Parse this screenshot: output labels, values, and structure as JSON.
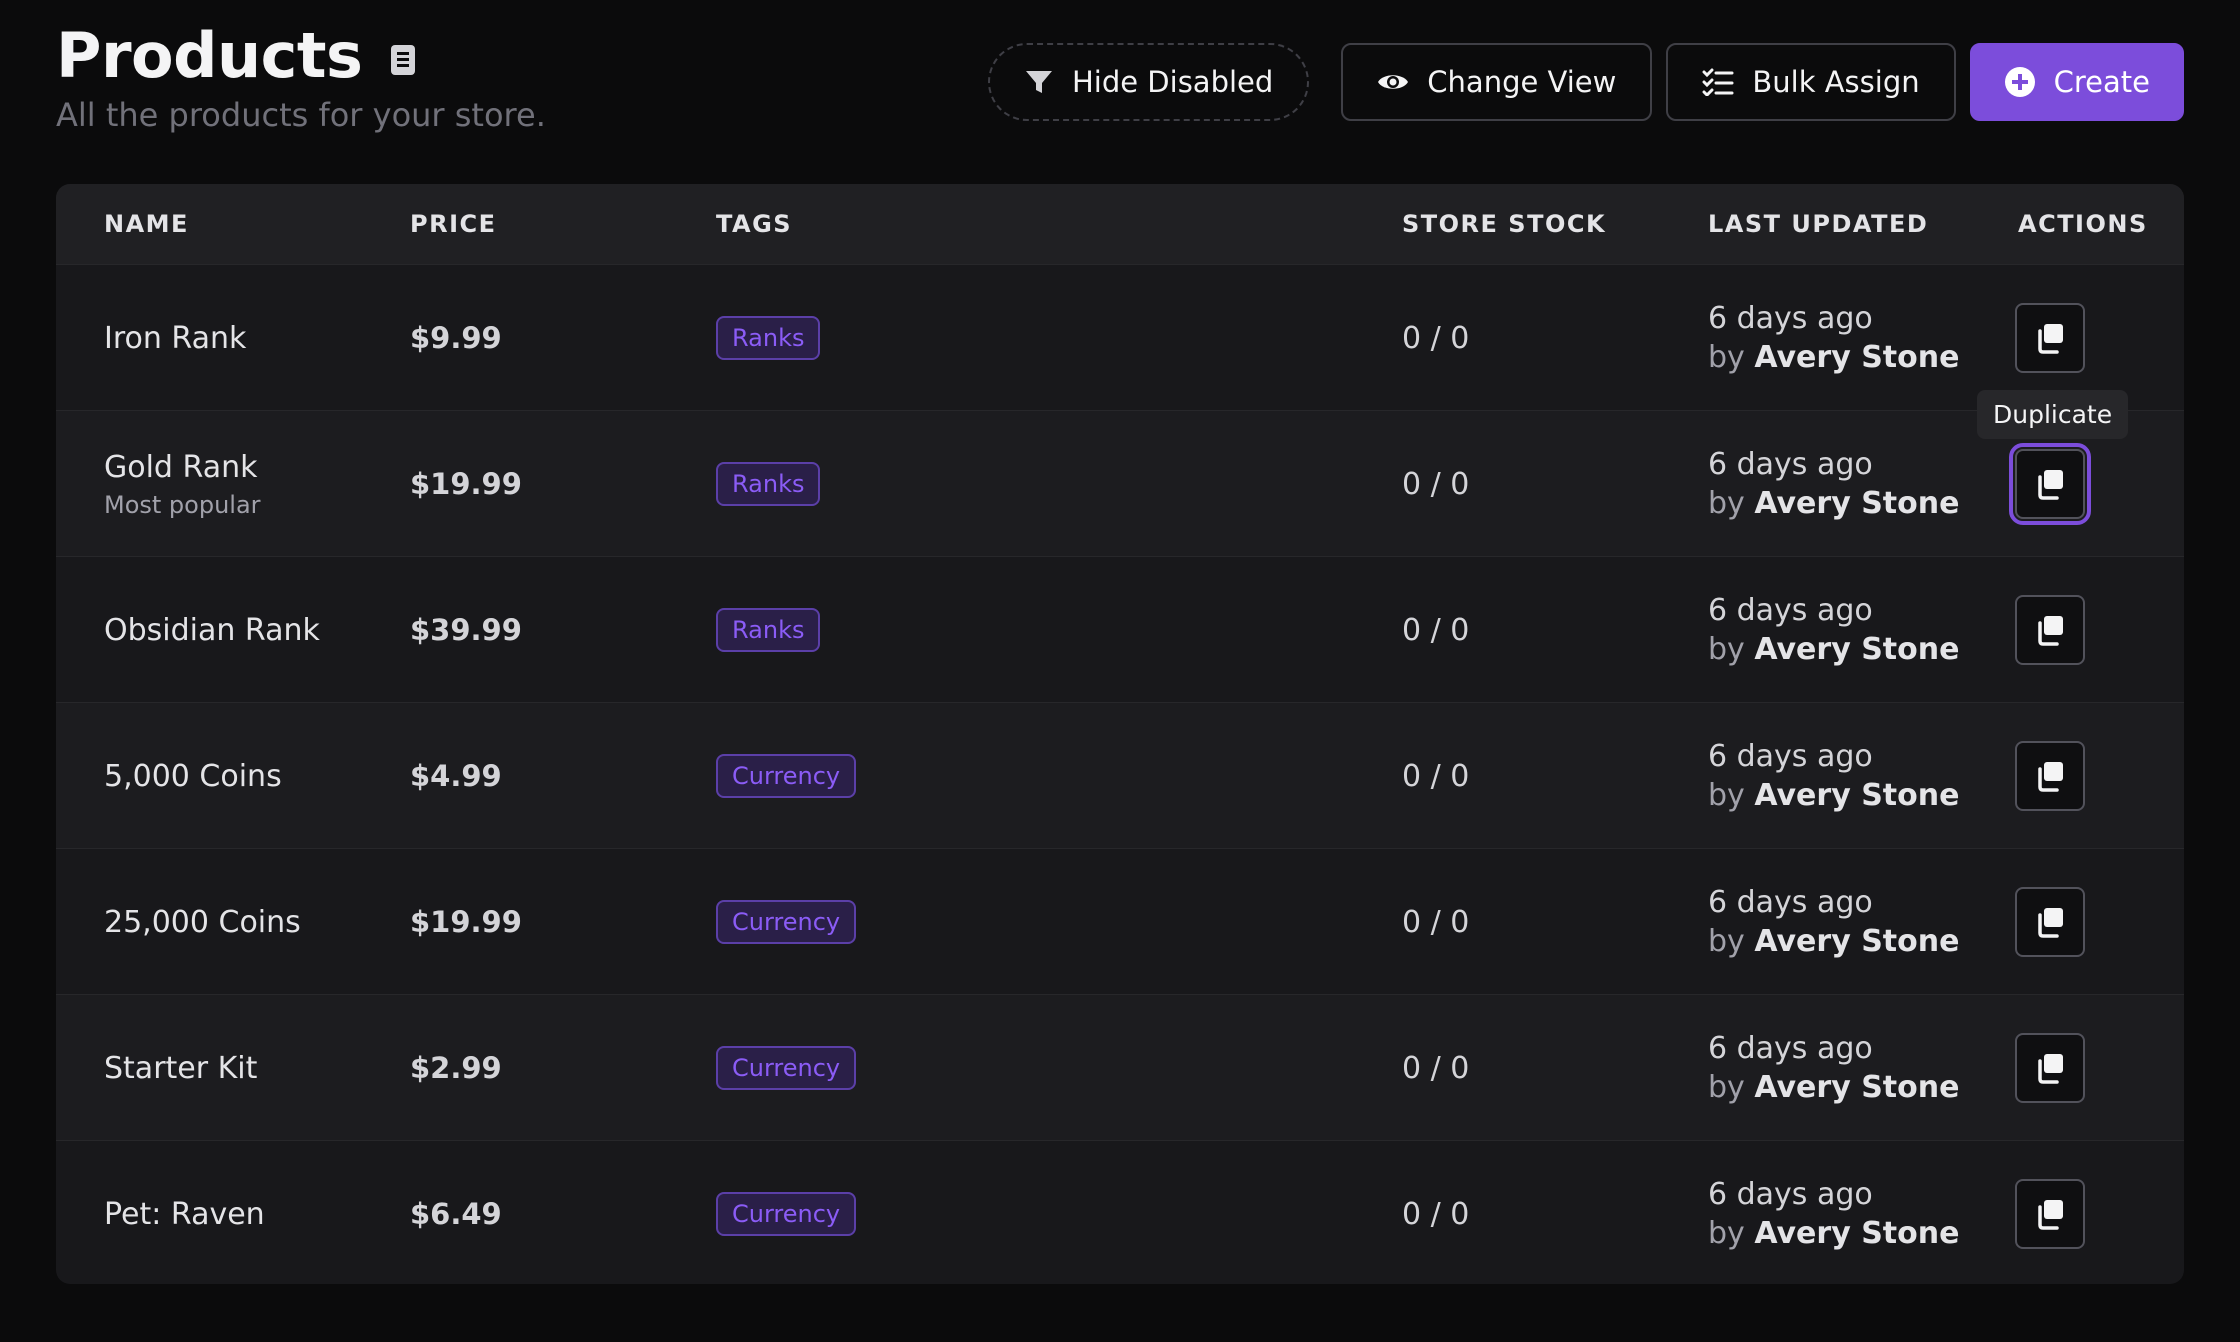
{
  "header": {
    "title": "Products",
    "docs_icon": "book-icon",
    "subtitle": "All the products for your store."
  },
  "toolbar": {
    "hide_disabled": "Hide Disabled",
    "change_view": "Change View",
    "bulk_assign": "Bulk Assign",
    "create": "Create"
  },
  "table": {
    "columns": [
      "NAME",
      "PRICE",
      "TAGS",
      "STORE STOCK",
      "LAST UPDATED",
      "ACTIONS"
    ],
    "rows": [
      {
        "name": "Iron Rank",
        "sub": "",
        "price": "$9.99",
        "tag": "Ranks",
        "stock": "0 / 0",
        "updated": "6 days ago",
        "by_prefix": "by",
        "by": "Avery Stone"
      },
      {
        "name": "Gold Rank",
        "sub": "Most popular",
        "price": "$19.99",
        "tag": "Ranks",
        "stock": "0 / 0",
        "updated": "6 days ago",
        "by_prefix": "by",
        "by": "Avery Stone"
      },
      {
        "name": "Obsidian Rank",
        "sub": "",
        "price": "$39.99",
        "tag": "Ranks",
        "stock": "0 / 0",
        "updated": "6 days ago",
        "by_prefix": "by",
        "by": "Avery Stone"
      },
      {
        "name": "5,000 Coins",
        "sub": "",
        "price": "$4.99",
        "tag": "Currency",
        "stock": "0 / 0",
        "updated": "6 days ago",
        "by_prefix": "by",
        "by": "Avery Stone"
      },
      {
        "name": "25,000 Coins",
        "sub": "",
        "price": "$19.99",
        "tag": "Currency",
        "stock": "0 / 0",
        "updated": "6 days ago",
        "by_prefix": "by",
        "by": "Avery Stone"
      },
      {
        "name": "Starter Kit",
        "sub": "",
        "price": "$2.99",
        "tag": "Currency",
        "stock": "0 / 0",
        "updated": "6 days ago",
        "by_prefix": "by",
        "by": "Avery Stone"
      },
      {
        "name": "Pet: Raven",
        "sub": "",
        "price": "$6.49",
        "tag": "Currency",
        "stock": "0 / 0",
        "updated": "6 days ago",
        "by_prefix": "by",
        "by": "Avery Stone"
      }
    ]
  },
  "tooltip": {
    "text": "Duplicate"
  },
  "colors": {
    "accent": "#7c4ddb",
    "tag_text": "#8b5cf6",
    "background": "#0b0b0c"
  }
}
